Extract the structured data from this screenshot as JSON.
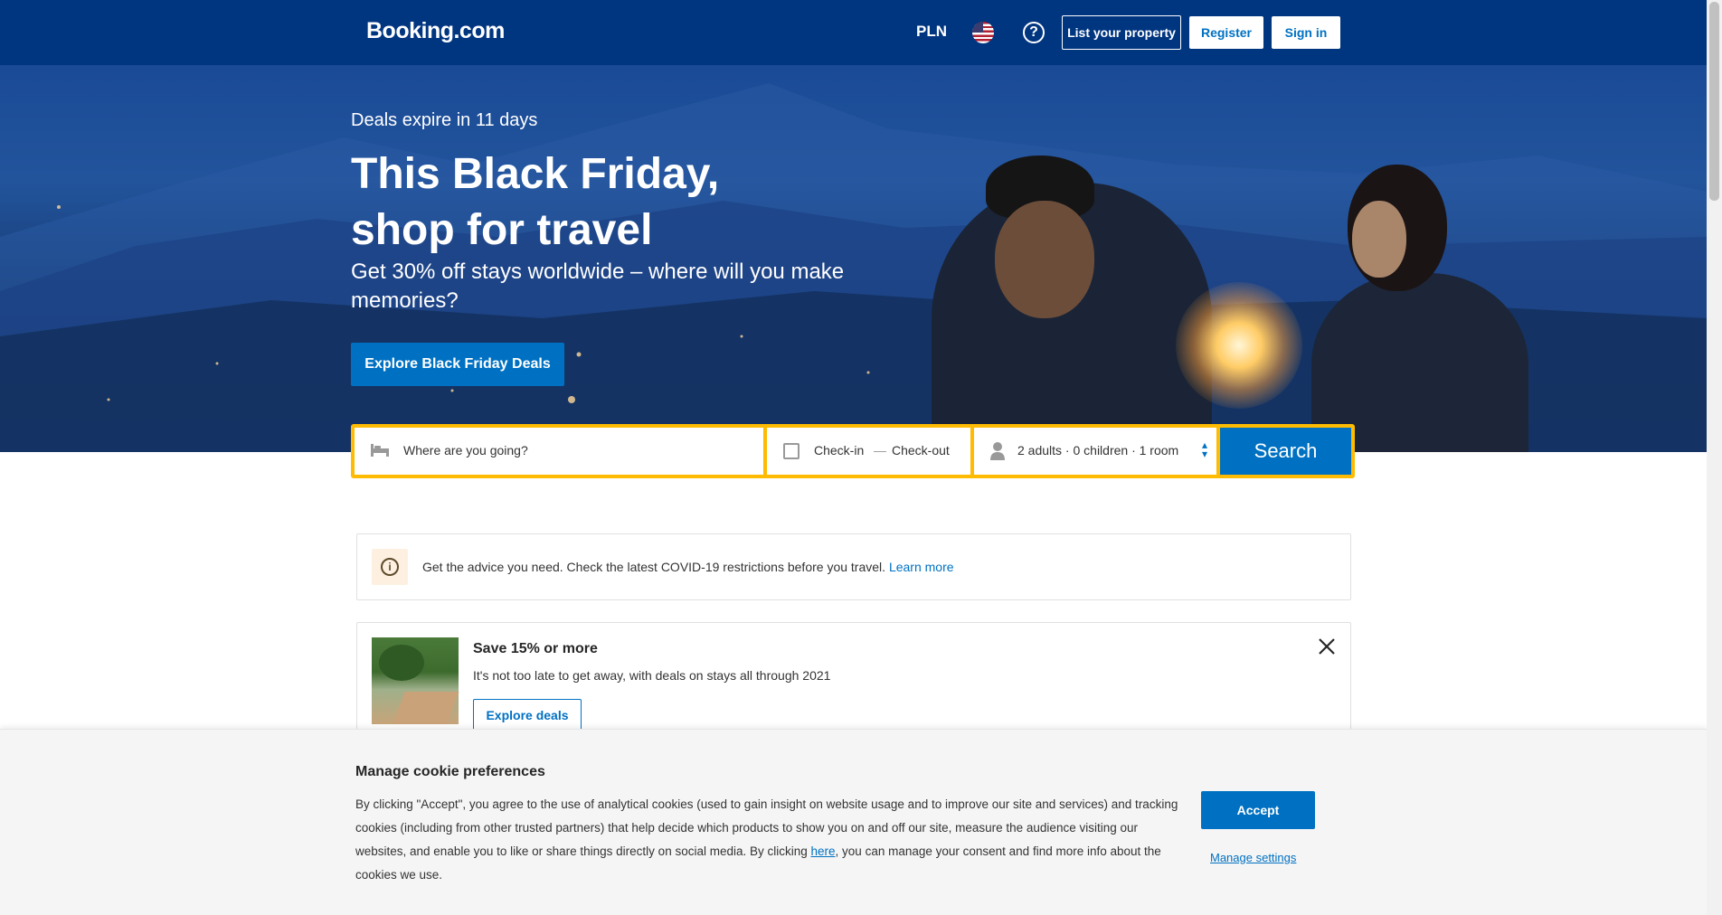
{
  "header": {
    "logo": "Booking.com",
    "currency": "PLN",
    "flag_icon": "us-flag-icon",
    "help_icon": "question-icon",
    "list_property": "List your property",
    "register": "Register",
    "sign_in": "Sign in"
  },
  "hero": {
    "subtitle": "Deals expire in 11 days",
    "title": "This Black Friday, shop for travel",
    "description": "Get 30% off stays worldwide – where will you make memories?",
    "cta": "Explore Black Friday Deals"
  },
  "search": {
    "destination_placeholder": "Where are you going?",
    "check_in": "Check-in",
    "check_out": "Check-out",
    "date_separator": "—",
    "guests": "2 adults · 0 children · 1 room",
    "button": "Search"
  },
  "notice": {
    "text": "Get the advice you need. Check the latest COVID-19 restrictions before you travel.",
    "link": "Learn more"
  },
  "promo": {
    "title": "Save 15% or more",
    "description": "It's not too late to get away, with deals on stays all through 2021",
    "button": "Explore deals"
  },
  "cookie": {
    "title": "Manage cookie preferences",
    "body_before": "By clicking \"Accept\", you agree to the use of analytical cookies (used to gain insight on website usage and to improve our site and services) and tracking cookies (including from other trusted partners) that help decide which products to show you on and off our site, measure the audience visiting our websites, and enable you to like or share things directly on social media. By clicking ",
    "body_link": "here",
    "body_after": ", you can manage your consent and find more info about the cookies we use.",
    "accept": "Accept",
    "manage": "Manage settings"
  },
  "colors": {
    "brand": "#003580",
    "accent": "#0071c2",
    "search_border": "#febb02"
  }
}
